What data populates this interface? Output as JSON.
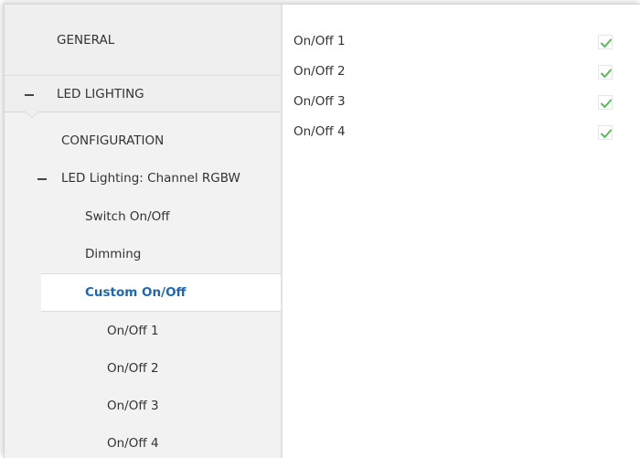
{
  "sidebar": {
    "general_label": "GENERAL",
    "led_lighting_label": "LED LIGHTING",
    "configuration_label": "CONFIGURATION",
    "channel_label": "LED Lighting: Channel RGBW",
    "switch_label": "Switch On/Off",
    "dimming_label": "Dimming",
    "custom_label": "Custom On/Off",
    "onoff_items": [
      "On/Off 1",
      "On/Off 2",
      "On/Off 3",
      "On/Off 4"
    ]
  },
  "content": {
    "params": [
      {
        "label": "On/Off 1",
        "checked": true
      },
      {
        "label": "On/Off 2",
        "checked": true
      },
      {
        "label": "On/Off 3",
        "checked": true
      },
      {
        "label": "On/Off 4",
        "checked": true
      }
    ]
  },
  "colors": {
    "selected_text": "#1c68b5",
    "check_mark": "#5cb85c",
    "sidebar_bg": "#f2f2f2"
  },
  "icons": {
    "collapse": "minus-icon",
    "check": "checkmark-icon"
  }
}
